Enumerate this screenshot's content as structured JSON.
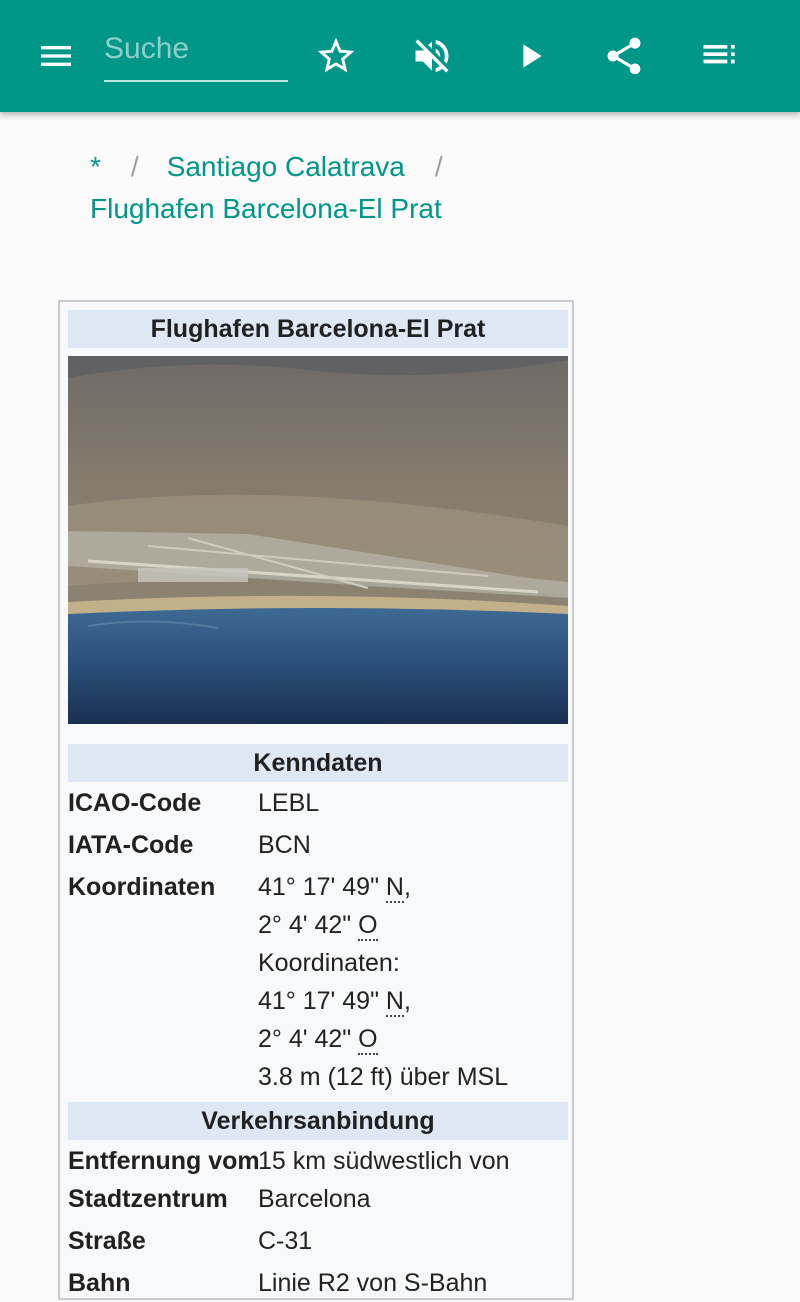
{
  "appbar": {
    "search_placeholder": "Suche",
    "background": "#009688",
    "icons": [
      "menu-icon",
      "star-outline-icon",
      "volume-off-icon",
      "play-icon",
      "share-icon",
      "playlist-icon"
    ]
  },
  "breadcrumb": {
    "root": "*",
    "separator": "/",
    "level1": "Santiago Calatrava",
    "level2": "Flughafen Barcelona-El Prat"
  },
  "infobox": {
    "title": "Flughafen Barcelona-El Prat",
    "section1": "Kenndaten",
    "icao_label": "ICAO-Code",
    "icao_value": "LEBL",
    "iata_label": "IATA-Code",
    "iata_value": "BCN",
    "coord_label": "Koordinaten",
    "coord1_lat": "41° 17' 49\"",
    "coord1_lat_dir": "N",
    "coord1_lon": "2° 4' 42\"",
    "coord1_lon_dir": "O",
    "coord_sub_label": "Koordinaten:",
    "coord2_lat": "41° 17' 49\"",
    "coord2_lat_dir": "N",
    "coord2_lon": "2° 4' 42\"",
    "coord2_lon_dir": "O",
    "elevation": "3.8 m (12 ft) über MSL",
    "section2": "Verkehrsanbindung",
    "distance_label_1": "Entfernung vom",
    "distance_label_2": "Stadtzentrum",
    "distance_value_1": "15 km südwestlich von",
    "distance_value_2": "Barcelona",
    "road_label": "Straße",
    "road_value": "C-31",
    "rail_label": "Bahn",
    "rail_value": "Linie R2 von S-Bahn"
  }
}
